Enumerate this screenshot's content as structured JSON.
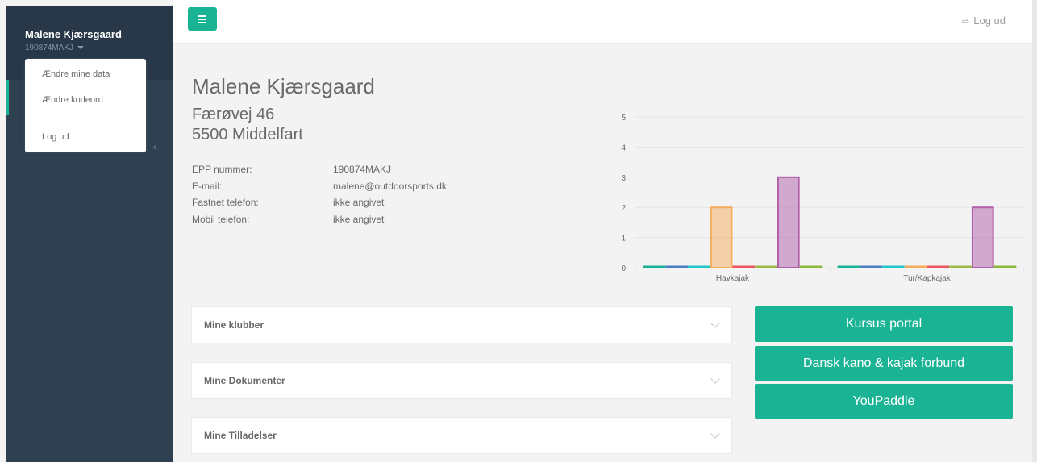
{
  "sidebar": {
    "user_name": "Malene Kjærsgaard",
    "user_id": "190874MAKJ",
    "collapse_icon": "chevron-left-icon",
    "dropdown": {
      "items": [
        "Ændre mine data",
        "Ændre kodeord",
        "Log ud"
      ]
    }
  },
  "topbar": {
    "menu_icon": "hamburger-icon",
    "logout_label": "Log ud",
    "logout_icon": "sign-out-icon"
  },
  "profile": {
    "name": "Malene Kjærsgaard",
    "street": "Færøvej 46",
    "city": "5500 Middelfart",
    "fields": [
      {
        "label": "EPP nummer:",
        "value": "190874MAKJ"
      },
      {
        "label": "E-mail:",
        "value": "malene@outdoorsports.dk"
      },
      {
        "label": "Fastnet telefon:",
        "value": "ikke angivet"
      },
      {
        "label": "Mobil telefon:",
        "value": "ikke angivet"
      }
    ]
  },
  "chart_data": {
    "type": "bar",
    "categories": [
      "Havkajak",
      "Tur/Kapkajak"
    ],
    "series": [
      {
        "color": "#1ab394",
        "values": [
          0,
          0
        ]
      },
      {
        "color": "#4a7fc1",
        "values": [
          0,
          0
        ]
      },
      {
        "color": "#23c6c8",
        "values": [
          0,
          0
        ]
      },
      {
        "color": "#f8ac59",
        "values": [
          2,
          0
        ]
      },
      {
        "color": "#ed5565",
        "values": [
          0,
          0
        ]
      },
      {
        "color": "#a0b84a",
        "values": [
          0,
          0
        ]
      },
      {
        "color": "#b05fa8",
        "values": [
          3,
          2
        ]
      },
      {
        "color": "#8cb83a",
        "values": [
          0,
          0
        ]
      }
    ],
    "yticks": [
      0,
      1,
      2,
      3,
      4,
      5
    ],
    "ylim": [
      0,
      5
    ],
    "grid": true,
    "legend": "none"
  },
  "panels": [
    {
      "title": "Mine klubber"
    },
    {
      "title": "Mine Dokumenter"
    },
    {
      "title": "Mine Tilladelser"
    }
  ],
  "actions": [
    "Kursus portal",
    "Dansk kano & kajak forbund",
    "YouPaddle"
  ],
  "colors": {
    "accent": "#1ab394",
    "sidebar": "#2f4050"
  }
}
